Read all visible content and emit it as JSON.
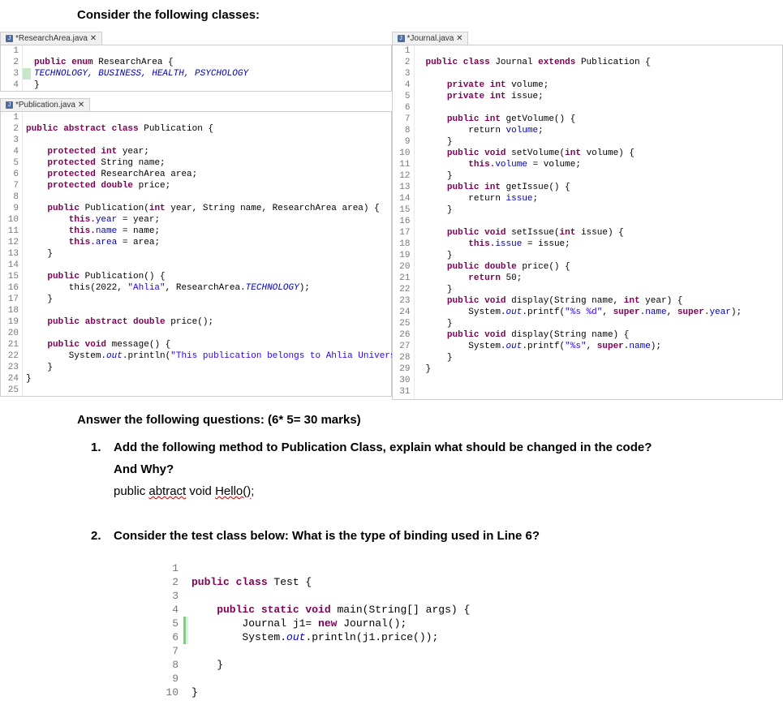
{
  "heading": "Consider the following classes:",
  "tabs": {
    "researchArea": "*ResearchArea.java",
    "publication": "*Publication.java",
    "journal": "*Journal.java"
  },
  "researchAreaCode": {
    "l1": "",
    "l2a": "public enum",
    "l2b": " ResearchArea {",
    "l3": "TECHNOLOGY, BUSINESS, HEALTH, PSYCHOLOGY",
    "l4": "}"
  },
  "publicationCode": {
    "l1": "",
    "l2a": "public abstract class",
    "l2b": " Publication {",
    "l3": "",
    "l4a": "    protected int",
    "l4b": " year;",
    "l5a": "    protected",
    "l5b": " String name;",
    "l6a": "    protected",
    "l6b": " ResearchArea area;",
    "l7a": "    protected double",
    "l7b": " price;",
    "l8": "",
    "l9a": "    public",
    "l9b": " Publication(",
    "l9c": "int",
    "l9d": " year, String name, ResearchArea area) {",
    "l10a": "        this.",
    "l10b": "year",
    "l10c": " = year;",
    "l11a": "        this.",
    "l11b": "name",
    "l11c": " = name;",
    "l12a": "        this.",
    "l12b": "area",
    "l12c": " = area;",
    "l13": "    }",
    "l14": "",
    "l15a": "    public",
    "l15b": " Publication() {",
    "l16a": "        this(2022, ",
    "l16b": "\"Ahlia\"",
    "l16c": ", ResearchArea.",
    "l16d": "TECHNOLOGY",
    "l16e": ");",
    "l17": "    }",
    "l18": "",
    "l19a": "    public abstract double",
    "l19b": " price();",
    "l20": "",
    "l21a": "    public void",
    "l21b": " message() {",
    "l22a": "        System.",
    "l22b": "out",
    "l22c": ".println(",
    "l22d": "\"This publication belongs to Ahlia University\"",
    "l22e": ");",
    "l23": "    }",
    "l24": "}",
    "l25": ""
  },
  "journalCode": {
    "l1": "",
    "l2a": "public class",
    "l2b": " Journal ",
    "l2c": "extends",
    "l2d": " Publication {",
    "l3": "",
    "l4a": "    private int",
    "l4b": " volume;",
    "l5a": "    private int",
    "l5b": " issue;",
    "l6": "",
    "l7a": "    public int",
    "l7b": " getVolume() {",
    "l8a": "        return ",
    "l8b": "volume",
    "l8c": ";",
    "l9": "    }",
    "l10a": "    public void",
    "l10b": " setVolume(",
    "l10c": "int",
    "l10d": " volume) {",
    "l11a": "        this.",
    "l11b": "volume",
    "l11c": " = volume;",
    "l12": "    }",
    "l13a": "    public int",
    "l13b": " getIssue() {",
    "l14a": "        return ",
    "l14b": "issue",
    "l14c": ";",
    "l15": "    }",
    "l16": "",
    "l17a": "    public void",
    "l17b": " setIssue(",
    "l17c": "int",
    "l17d": " issue) {",
    "l18a": "        this.",
    "l18b": "issue",
    "l18c": " = issue;",
    "l19": "    }",
    "l20a": "    public double",
    "l20b": " price() {",
    "l21a": "        return",
    "l21b": " 50;",
    "l22": "    }",
    "l23a": "    public void",
    "l23b": " display(String name, ",
    "l23c": "int",
    "l23d": " year) {",
    "l24a": "        System.",
    "l24b": "out",
    "l24c": ".printf(",
    "l24d": "\"%s %d\"",
    "l24e": ", ",
    "l24f": "super",
    "l24g": ".",
    "l24h": "name",
    "l24i": ", ",
    "l24j": "super",
    "l24k": ".",
    "l24l": "year",
    "l24m": ");",
    "l25": "    }",
    "l26a": "    public void",
    "l26b": " display(String name) {",
    "l27a": "        System.",
    "l27b": "out",
    "l27c": ".printf(",
    "l27d": "\"%s\"",
    "l27e": ", ",
    "l27f": "super",
    "l27g": ".",
    "l27h": "name",
    "l27i": ");",
    "l28": "    }",
    "l29": "}",
    "l30": "",
    "l31": ""
  },
  "answerHeading": "Answer the following questions: (6* 5= 30 marks)",
  "q1": {
    "num": "1.",
    "line1": "Add the following method to Publication Class, explain what should be changed in the code?",
    "line2": "And Why?",
    "line3a": "public ",
    "line3b": "abtract",
    "line3c": " void ",
    "line3d": "Hello()",
    "line3e": ";"
  },
  "q2": {
    "num": "2.",
    "line1": "Consider the test class below: What is the type of binding used in Line 6?"
  },
  "testCode": {
    "l1": "",
    "l2a": "public class",
    "l2b": " Test {",
    "l3": "",
    "l4a": "    public static void",
    "l4b": " main(String[] args) {",
    "l5a": "        Journal j1= ",
    "l5b": "new",
    "l5c": " Journal();",
    "l6a": "        System.",
    "l6b": "out",
    "l6c": ".println(j1.price());",
    "l7": "",
    "l8": "    }",
    "l9": "",
    "l10": "}"
  }
}
